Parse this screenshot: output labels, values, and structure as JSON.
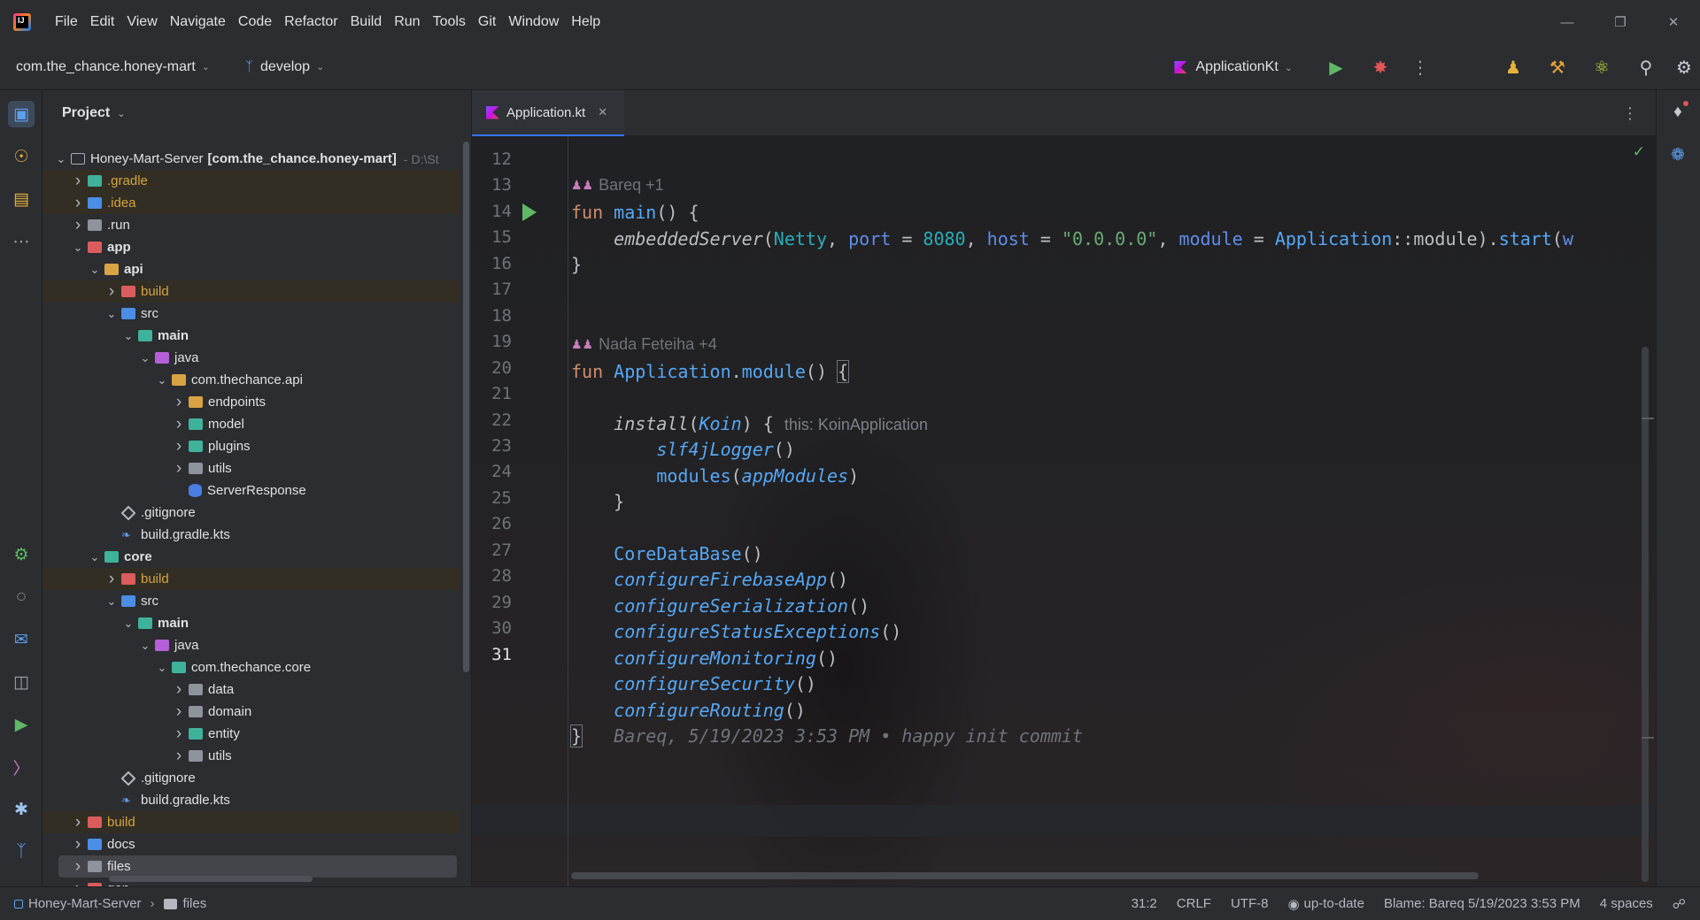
{
  "menu": [
    "File",
    "Edit",
    "View",
    "Navigate",
    "Code",
    "Refactor",
    "Build",
    "Run",
    "Tools",
    "Git",
    "Window",
    "Help"
  ],
  "app_logo_text": "IJ",
  "toolbar": {
    "project": "com.the_chance.honey-mart",
    "branch": "develop",
    "run_config": "ApplicationKt"
  },
  "project_panel": {
    "title": "Project",
    "tree": [
      {
        "label": "Honey-Mart-Server",
        "bold_suffix": "[com.the_chance.honey-mart]",
        "path": "- D:\\St",
        "arrow": "v",
        "icon": "folder-outline"
      },
      {
        "label": ".gradle",
        "arrow": ">",
        "icon": "folder-teal",
        "gold": true
      },
      {
        "label": ".idea",
        "arrow": ">",
        "icon": "folder-blue",
        "gold": true
      },
      {
        "label": ".run",
        "arrow": ">",
        "icon": "folder-grey"
      },
      {
        "label": "app",
        "arrow": "v",
        "icon": "folder-red",
        "bold": true
      },
      {
        "label": "api",
        "arrow": "v",
        "icon": "folder-gold",
        "bold": true
      },
      {
        "label": "build",
        "arrow": ">",
        "icon": "folder-red",
        "gold": true
      },
      {
        "label": "src",
        "arrow": "v",
        "icon": "folder-blue"
      },
      {
        "label": "main",
        "arrow": "v",
        "icon": "folder-teal",
        "bold": true
      },
      {
        "label": "java",
        "arrow": "v",
        "icon": "folder-purple"
      },
      {
        "label": "com.thechance.api",
        "arrow": "v",
        "icon": "folder-gold"
      },
      {
        "label": "endpoints",
        "arrow": ">",
        "icon": "folder-gold"
      },
      {
        "label": "model",
        "arrow": ">",
        "icon": "folder-teal"
      },
      {
        "label": "plugins",
        "arrow": ">",
        "icon": "folder-teal"
      },
      {
        "label": "utils",
        "arrow": ">",
        "icon": "folder-grey"
      },
      {
        "label": "ServerResponse",
        "arrow": "",
        "icon": "kt"
      },
      {
        "label": ".gitignore",
        "arrow": "",
        "icon": "git"
      },
      {
        "label": "build.gradle.kts",
        "arrow": "",
        "icon": "gradle"
      },
      {
        "label": "core",
        "arrow": "v",
        "icon": "folder-teal",
        "bold": true
      },
      {
        "label": "build",
        "arrow": ">",
        "icon": "folder-red",
        "gold": true
      },
      {
        "label": "src",
        "arrow": "v",
        "icon": "folder-blue"
      },
      {
        "label": "main",
        "arrow": "v",
        "icon": "folder-teal",
        "bold": true
      },
      {
        "label": "java",
        "arrow": "v",
        "icon": "folder-purple"
      },
      {
        "label": "com.thechance.core",
        "arrow": "v",
        "icon": "folder-teal"
      },
      {
        "label": "data",
        "arrow": ">",
        "icon": "folder-grey"
      },
      {
        "label": "domain",
        "arrow": ">",
        "icon": "folder-grey"
      },
      {
        "label": "entity",
        "arrow": ">",
        "icon": "folder-teal"
      },
      {
        "label": "utils",
        "arrow": ">",
        "icon": "folder-grey"
      },
      {
        "label": ".gitignore",
        "arrow": "",
        "icon": "git"
      },
      {
        "label": "build.gradle.kts",
        "arrow": "",
        "icon": "gradle"
      },
      {
        "label": "build",
        "arrow": ">",
        "icon": "folder-red",
        "gold": true
      },
      {
        "label": "docs",
        "arrow": ">",
        "icon": "folder-blue"
      },
      {
        "label": "files",
        "arrow": ">",
        "icon": "folder-grey",
        "selected": true
      },
      {
        "label": "gen",
        "arrow": ">",
        "icon": "folder-red"
      }
    ]
  },
  "editor": {
    "tab": "Application.kt",
    "line_numbers": [
      "12",
      "13",
      "14",
      "15",
      "16",
      "17",
      "18",
      "19",
      "20",
      "21",
      "22",
      "23",
      "24",
      "25",
      "26",
      "27",
      "28",
      "29",
      "30",
      "31"
    ],
    "author_main": "Bareq +1",
    "author_module": "Nada Feteiha +4",
    "hint_koin": "this: KoinApplication",
    "blame_inline": "Bareq, 5/19/2023 3:53 PM • happy init commit"
  },
  "statusbar": {
    "breadcrumb_root": "Honey-Mart-Server",
    "breadcrumb_leaf": "files",
    "position": "31:2",
    "line_sep": "CRLF",
    "encoding": "UTF-8",
    "vcs_status": "up-to-date",
    "blame": "Blame: Bareq 5/19/2023 3:53 PM",
    "indent": "4 spaces"
  },
  "colors": {
    "accent": "#3574f0",
    "keyword": "#cf8e6d",
    "function": "#56a8f5",
    "number": "#2aacb8",
    "string": "#6aab73",
    "run_green": "#5fb865"
  }
}
